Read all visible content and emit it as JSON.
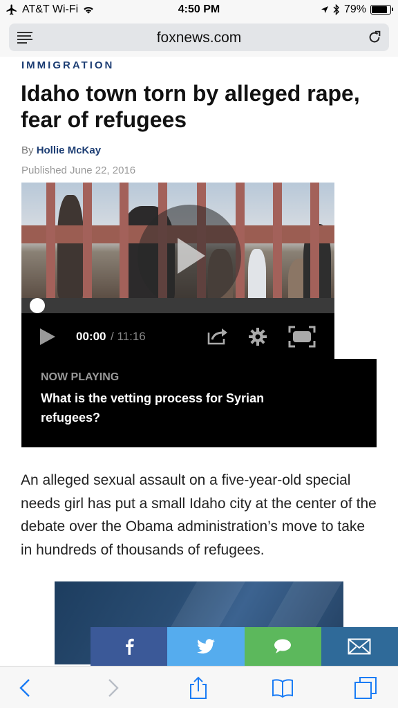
{
  "status_bar": {
    "carrier": "AT&T Wi-Fi",
    "time": "4:50 PM",
    "battery": "79%",
    "battery_level": 0.79
  },
  "url_bar": {
    "domain": "foxnews.com"
  },
  "article": {
    "category": "IMMIGRATION",
    "headline": "Idaho town torn by alleged rape, fear of refugees",
    "by_prefix": "By",
    "author": "Hollie McKay",
    "published": "Published June 22, 2016",
    "body": "An alleged sexual assault on a five-year-old special needs girl has put a small Idaho city at the center of the debate over the Obama administration’s move to take in hundreds of thousands of refugees."
  },
  "video": {
    "current_time": "00:00",
    "total_time": "/ 11:16",
    "now_playing_label": "NOW PLAYING",
    "now_playing_title": "What is the vetting process for Syrian refugees?"
  },
  "share_bar": {
    "buttons": [
      {
        "icon": "facebook-icon",
        "color": "#3b5998"
      },
      {
        "icon": "twitter-icon",
        "color": "#55acee"
      },
      {
        "icon": "comment-icon",
        "color": "#5cb85c"
      },
      {
        "icon": "email-icon",
        "color": "#2f6a99"
      }
    ]
  },
  "toolbar": {
    "icons": [
      "back-icon",
      "forward-icon",
      "share-icon",
      "bookmarks-icon",
      "tabs-icon"
    ],
    "accent": "#1a7cf5"
  }
}
